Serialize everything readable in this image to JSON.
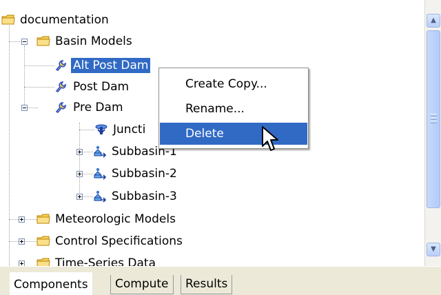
{
  "tree": {
    "items": [
      {
        "label": "documentation",
        "icon": "folder-icon"
      },
      {
        "label": "Basin Models",
        "icon": "folder-icon"
      },
      {
        "label": "Alt Post Dam",
        "icon": "basin-model-icon",
        "selected": true
      },
      {
        "label": "Post Dam",
        "icon": "basin-model-icon"
      },
      {
        "label": "Pre Dam",
        "icon": "basin-model-icon"
      },
      {
        "label": "Juncti",
        "icon": "junction-icon"
      },
      {
        "label": "Subbasin-1",
        "icon": "subbasin-icon"
      },
      {
        "label": "Subbasin-2",
        "icon": "subbasin-icon"
      },
      {
        "label": "Subbasin-3",
        "icon": "subbasin-icon"
      },
      {
        "label": "Meteorologic Models",
        "icon": "folder-icon"
      },
      {
        "label": "Control Specifications",
        "icon": "folder-icon"
      },
      {
        "label": "Time-Series Data",
        "icon": "folder-icon"
      }
    ]
  },
  "context_menu": {
    "items": [
      {
        "label": "Create Copy..."
      },
      {
        "label": "Rename..."
      },
      {
        "label": "Delete",
        "highlighted": true
      }
    ]
  },
  "tabs": [
    {
      "label": "Components",
      "active": true
    },
    {
      "label": "Compute"
    },
    {
      "label": "Results"
    }
  ],
  "colors": {
    "selection": "#316ac5",
    "folder": "#f3cf55",
    "basin_icon": "#2d4fc8",
    "panel_bg": "#ece9d8"
  },
  "icons": {
    "scroll_up": "chevron-up-icon",
    "scroll_down": "chevron-down-icon",
    "cursor": "mouse-pointer-icon"
  }
}
